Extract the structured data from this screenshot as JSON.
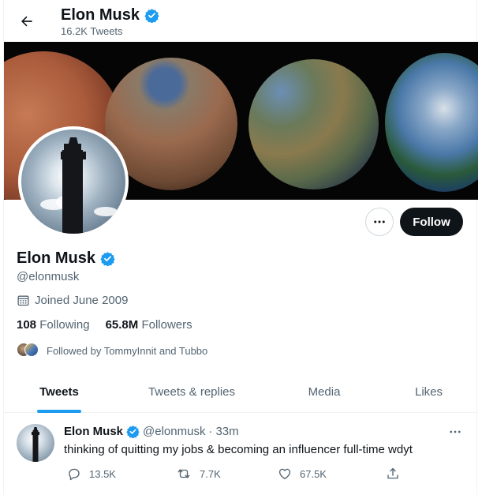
{
  "header": {
    "name": "Elon Musk",
    "tweet_count": "16.2K Tweets"
  },
  "profile": {
    "name": "Elon Musk",
    "handle": "@elonmusk",
    "joined": "Joined June 2009",
    "following_count": "108",
    "following_label": "Following",
    "followers_count": "65.8M",
    "followers_label": "Followers",
    "followed_by": "Followed by TommyInnit and Tubbo",
    "follow_button": "Follow"
  },
  "tabs": [
    {
      "label": "Tweets",
      "active": true
    },
    {
      "label": "Tweets & replies",
      "active": false
    },
    {
      "label": "Media",
      "active": false
    },
    {
      "label": "Likes",
      "active": false
    }
  ],
  "tweet": {
    "name": "Elon Musk",
    "handle": "@elonmusk",
    "separator": "·",
    "time": "33m",
    "text": "thinking of quitting my jobs & becoming an influencer full-time wdyt",
    "replies": "13.5K",
    "retweets": "7.7K",
    "likes": "67.5K"
  },
  "colors": {
    "accent": "#1d9bf0",
    "text_primary": "#0f1419",
    "text_secondary": "#536471",
    "follow_button_bg": "#0f1419"
  },
  "icons": {
    "back": "arrow-left-icon",
    "verified": "verified-badge-icon",
    "calendar": "calendar-icon",
    "more": "more-horizontal-icon",
    "reply": "reply-icon",
    "retweet": "retweet-icon",
    "like": "heart-icon",
    "share": "share-icon"
  }
}
